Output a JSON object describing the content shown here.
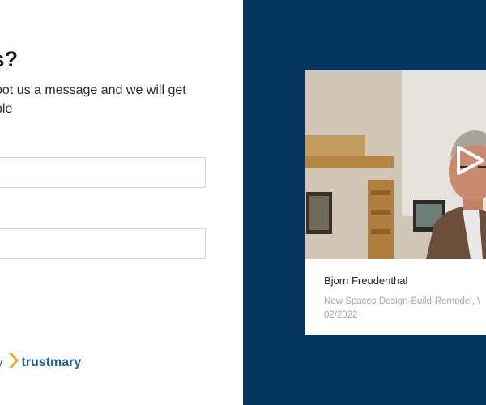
{
  "form": {
    "heading": "ions?",
    "subtext_line1": "oot us a message and we will get",
    "subtext_line2": "ble",
    "field1_value": "",
    "field2_value": ""
  },
  "powered": {
    "by_text": "y",
    "brand": "trustmary",
    "brand_color": "#1f5fa8",
    "logo_color": "#f5a623"
  },
  "testimonial": {
    "name": "Bjorn Freudenthal",
    "company_line1": "New Spaces Design-Build-Remodel, \\",
    "company_line2": "02/2022",
    "play_icon": "play-icon"
  },
  "colors": {
    "panel_bg": "#063561",
    "card_bg": "#ffffff"
  }
}
